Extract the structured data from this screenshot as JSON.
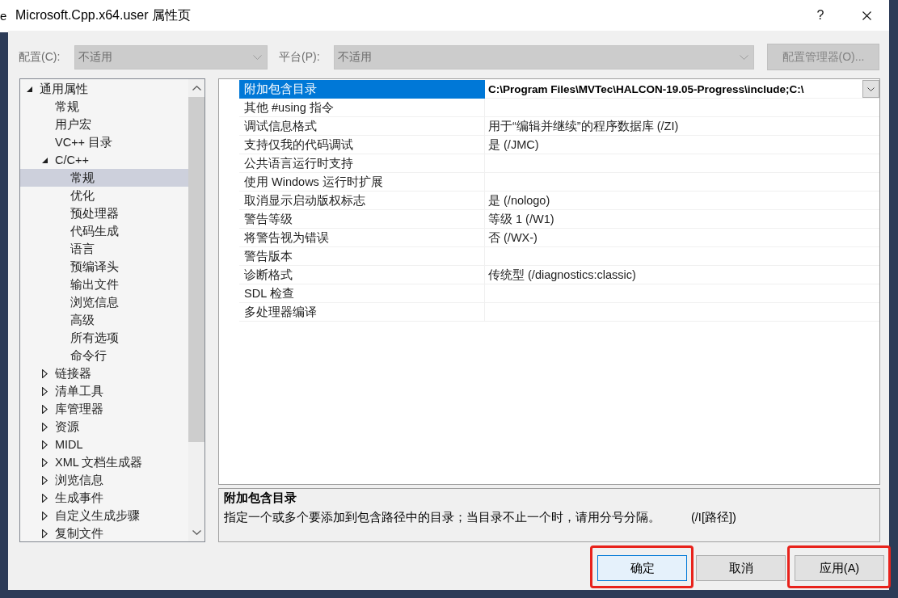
{
  "background_window": {
    "visible_text": "e"
  },
  "window": {
    "title": "Microsoft.Cpp.x64.user 属性页",
    "help": "?"
  },
  "config_bar": {
    "configuration": {
      "label": "配置(C):",
      "value": "不适用",
      "disabled": true
    },
    "platform": {
      "label": "平台(P):",
      "value": "不适用",
      "disabled": true
    },
    "manager_button": {
      "label": "配置管理器(O)...",
      "disabled": true
    }
  },
  "tree": {
    "items": [
      {
        "label": "通用属性",
        "kind": "category",
        "expanded": true,
        "selected": false,
        "children": [
          {
            "label": "常规",
            "kind": "page",
            "selected": false
          },
          {
            "label": "用户宏",
            "kind": "page",
            "selected": false
          },
          {
            "label": "VC++ 目录",
            "kind": "page",
            "selected": false
          },
          {
            "label": "C/C++",
            "kind": "category",
            "expanded": true,
            "selected": false,
            "children": [
              {
                "label": "常规",
                "kind": "page",
                "selected": true
              },
              {
                "label": "优化",
                "kind": "page",
                "selected": false
              },
              {
                "label": "预处理器",
                "kind": "page",
                "selected": false
              },
              {
                "label": "代码生成",
                "kind": "page",
                "selected": false
              },
              {
                "label": "语言",
                "kind": "page",
                "selected": false
              },
              {
                "label": "预编译头",
                "kind": "page",
                "selected": false
              },
              {
                "label": "输出文件",
                "kind": "page",
                "selected": false
              },
              {
                "label": "浏览信息",
                "kind": "page",
                "selected": false
              },
              {
                "label": "高级",
                "kind": "page",
                "selected": false
              },
              {
                "label": "所有选项",
                "kind": "page",
                "selected": false
              },
              {
                "label": "命令行",
                "kind": "page",
                "selected": false
              }
            ]
          },
          {
            "label": "链接器",
            "kind": "category",
            "expanded": false,
            "selected": false
          },
          {
            "label": "清单工具",
            "kind": "category",
            "expanded": false,
            "selected": false
          },
          {
            "label": "库管理器",
            "kind": "category",
            "expanded": false,
            "selected": false
          },
          {
            "label": "资源",
            "kind": "category",
            "expanded": false,
            "selected": false
          },
          {
            "label": "MIDL",
            "kind": "category",
            "expanded": false,
            "selected": false
          },
          {
            "label": "XML 文档生成器",
            "kind": "category",
            "expanded": false,
            "selected": false
          },
          {
            "label": "浏览信息",
            "kind": "category",
            "expanded": false,
            "selected": false
          },
          {
            "label": "生成事件",
            "kind": "category",
            "expanded": false,
            "selected": false
          },
          {
            "label": "自定义生成步骤",
            "kind": "category",
            "expanded": false,
            "selected": false
          },
          {
            "label": "复制文件",
            "kind": "category",
            "expanded": false,
            "selected": false
          }
        ]
      }
    ]
  },
  "property_grid": {
    "rows": [
      {
        "name": "附加包含目录",
        "value": "C:\\Program Files\\MVTec\\HALCON-19.05-Progress\\include;C:\\",
        "modified": true,
        "selected": true
      },
      {
        "name": "其他 #using 指令",
        "selected": false
      },
      {
        "name": "调试信息格式",
        "value": "用于“编辑并继续”的程序数据库 (/ZI)",
        "modified": false,
        "selected": false
      },
      {
        "name": "支持仅我的代码调试",
        "value": "是 (/JMC)",
        "modified": false,
        "selected": false
      },
      {
        "name": "公共语言运行时支持",
        "selected": false
      },
      {
        "name": "使用 Windows 运行时扩展",
        "selected": false
      },
      {
        "name": "取消显示启动版权标志",
        "value": "是 (/nologo)",
        "modified": false,
        "selected": false
      },
      {
        "name": "警告等级",
        "value": "等级 1 (/W1)",
        "modified": false,
        "selected": false
      },
      {
        "name": "将警告视为错误",
        "value": "否 (/WX-)",
        "modified": false,
        "selected": false
      },
      {
        "name": "警告版本",
        "selected": false
      },
      {
        "name": "诊断格式",
        "value": "传统型 (/diagnostics:classic)",
        "modified": false,
        "selected": false
      },
      {
        "name": "SDL 检查",
        "selected": false
      },
      {
        "name": "多处理器编译",
        "selected": false
      }
    ]
  },
  "description": {
    "title": "附加包含目录",
    "text": "指定一个或多个要添加到包含路径中的目录；当目录不止一个时，请用分号分隔。",
    "switch": "(/I[路径])"
  },
  "buttons": [
    {
      "label": "确定",
      "default": true,
      "highlighted": true
    },
    {
      "label": "取消",
      "default": false,
      "highlighted": false
    },
    {
      "label": "应用(A)",
      "default": false,
      "highlighted": true
    }
  ]
}
